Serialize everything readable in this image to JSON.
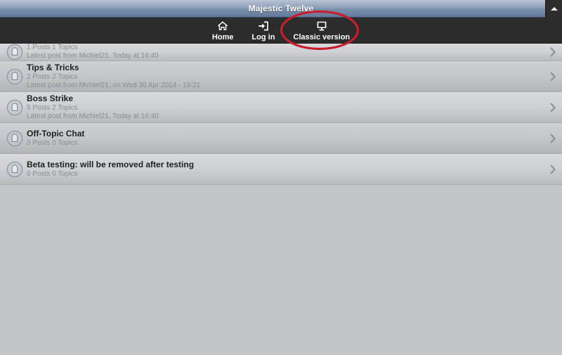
{
  "titlebar": {
    "title": "Majestic Twelve",
    "collapse_icon": "caret-up-icon"
  },
  "nav": {
    "items": [
      {
        "label": "Home",
        "icon": "home-icon"
      },
      {
        "label": "Log in",
        "icon": "login-icon"
      },
      {
        "label": "Classic version",
        "icon": "desktop-monitor-icon"
      }
    ]
  },
  "annotation": {
    "shape": "ellipse",
    "color": "#c81e2d",
    "target": "Classic version"
  },
  "boards": [
    {
      "title": "",
      "stats": "1 Posts 1 Topics",
      "latest": "Latest post from Michiel21, Today at 16:40",
      "icon": "board-icon",
      "chevron": "chevron-right-icon",
      "clipped": true
    },
    {
      "title": "Tips & Tricks",
      "stats": "2 Posts 2 Topics",
      "latest": "Latest post from Michiel21, on Wed 30 Apr 2014 - 19:21",
      "icon": "board-icon",
      "chevron": "chevron-right-icon",
      "clipped": false
    },
    {
      "title": "Boss Strike",
      "stats": "5 Posts 2 Topics",
      "latest": "Latest post from Michiel21, Today at 16:40",
      "icon": "board-icon",
      "chevron": "chevron-right-icon",
      "clipped": false
    },
    {
      "title": "Off-Topic Chat",
      "stats": "0 Posts 0 Topics",
      "latest": "",
      "icon": "board-icon",
      "chevron": "chevron-right-icon",
      "clipped": false
    },
    {
      "title": "Beta testing: will be removed after testing",
      "stats": "0 Posts 0 Topics",
      "latest": "",
      "icon": "board-icon",
      "chevron": "chevron-right-icon",
      "clipped": false
    }
  ],
  "colors": {
    "titlebar_text": "#ffffff",
    "navbar_bg": "#2c2c2c",
    "page_bg": "#c4c5c7",
    "row_title": "#1e1f21",
    "row_meta": "#8a8c90",
    "annotation": "#c81e2d"
  }
}
